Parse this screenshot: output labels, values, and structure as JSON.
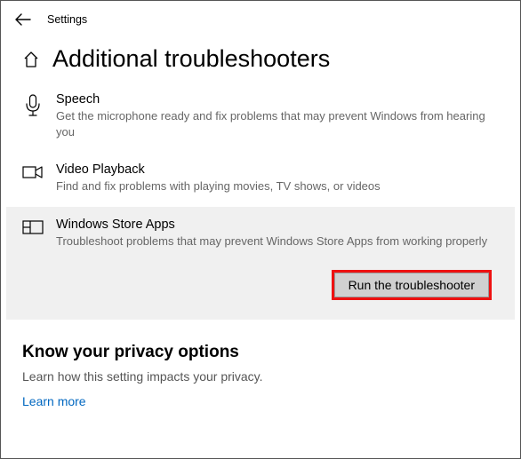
{
  "header": {
    "label": "Settings",
    "title": "Additional troubleshooters"
  },
  "items": [
    {
      "title": "Speech",
      "description": "Get the microphone ready and fix problems that may prevent Windows from hearing you"
    },
    {
      "title": "Video Playback",
      "description": "Find and fix problems with playing movies, TV shows, or videos"
    },
    {
      "title": "Windows Store Apps",
      "description": "Troubleshoot problems that may prevent Windows Store Apps from working properly"
    }
  ],
  "run_button": "Run the troubleshooter",
  "privacy": {
    "title": "Know your privacy options",
    "description": "Learn how this setting impacts your privacy.",
    "learn_more": "Learn more"
  }
}
